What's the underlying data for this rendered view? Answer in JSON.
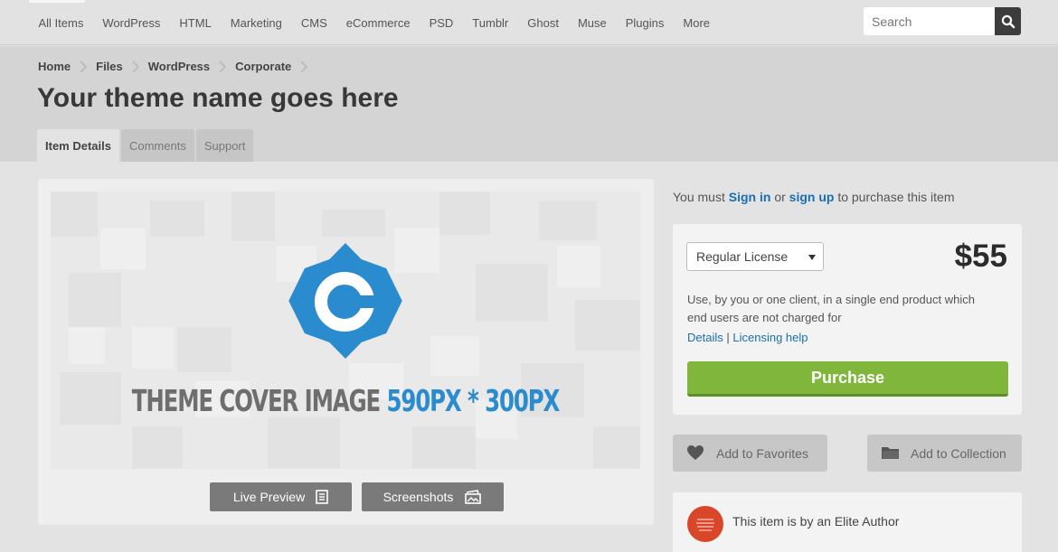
{
  "nav": {
    "items": [
      "All Items",
      "WordPress",
      "HTML",
      "Marketing",
      "CMS",
      "eCommerce",
      "PSD",
      "Tumblr",
      "Ghost",
      "Muse",
      "Plugins",
      "More"
    ],
    "search_placeholder": "Search",
    "search_icon": "search-icon"
  },
  "breadcrumb": [
    "Home",
    "Files",
    "WordPress",
    "Corporate"
  ],
  "page_title": "Your theme name goes here",
  "tabs": [
    "Item Details",
    "Comments",
    "Support"
  ],
  "cover": {
    "text_gray": "THEME COVER IMAGE",
    "text_blue": "590PX * 300PX",
    "logo_letter": "C",
    "accent": "#2b8bcf"
  },
  "preview_buttons": {
    "live_preview": "Live Preview",
    "screenshots": "Screenshots"
  },
  "signin": {
    "prefix": "You must",
    "sign_in": "Sign in",
    "or": "or",
    "sign_up": "sign up",
    "suffix": "to purchase this item"
  },
  "purchase": {
    "license": "Regular License",
    "price": "$55",
    "desc": "Use, by you or one client, in a single end product which end users are not charged for",
    "details_link": "Details",
    "separator": "|",
    "help_link": "Licensing help",
    "button": "Purchase",
    "button_color": "#80b63c"
  },
  "actions": {
    "favorites": "Add to Favorites",
    "collection": "Add to Collection"
  },
  "elite": {
    "text": "This item is by an Elite Author",
    "badge_color": "#d9472b"
  }
}
